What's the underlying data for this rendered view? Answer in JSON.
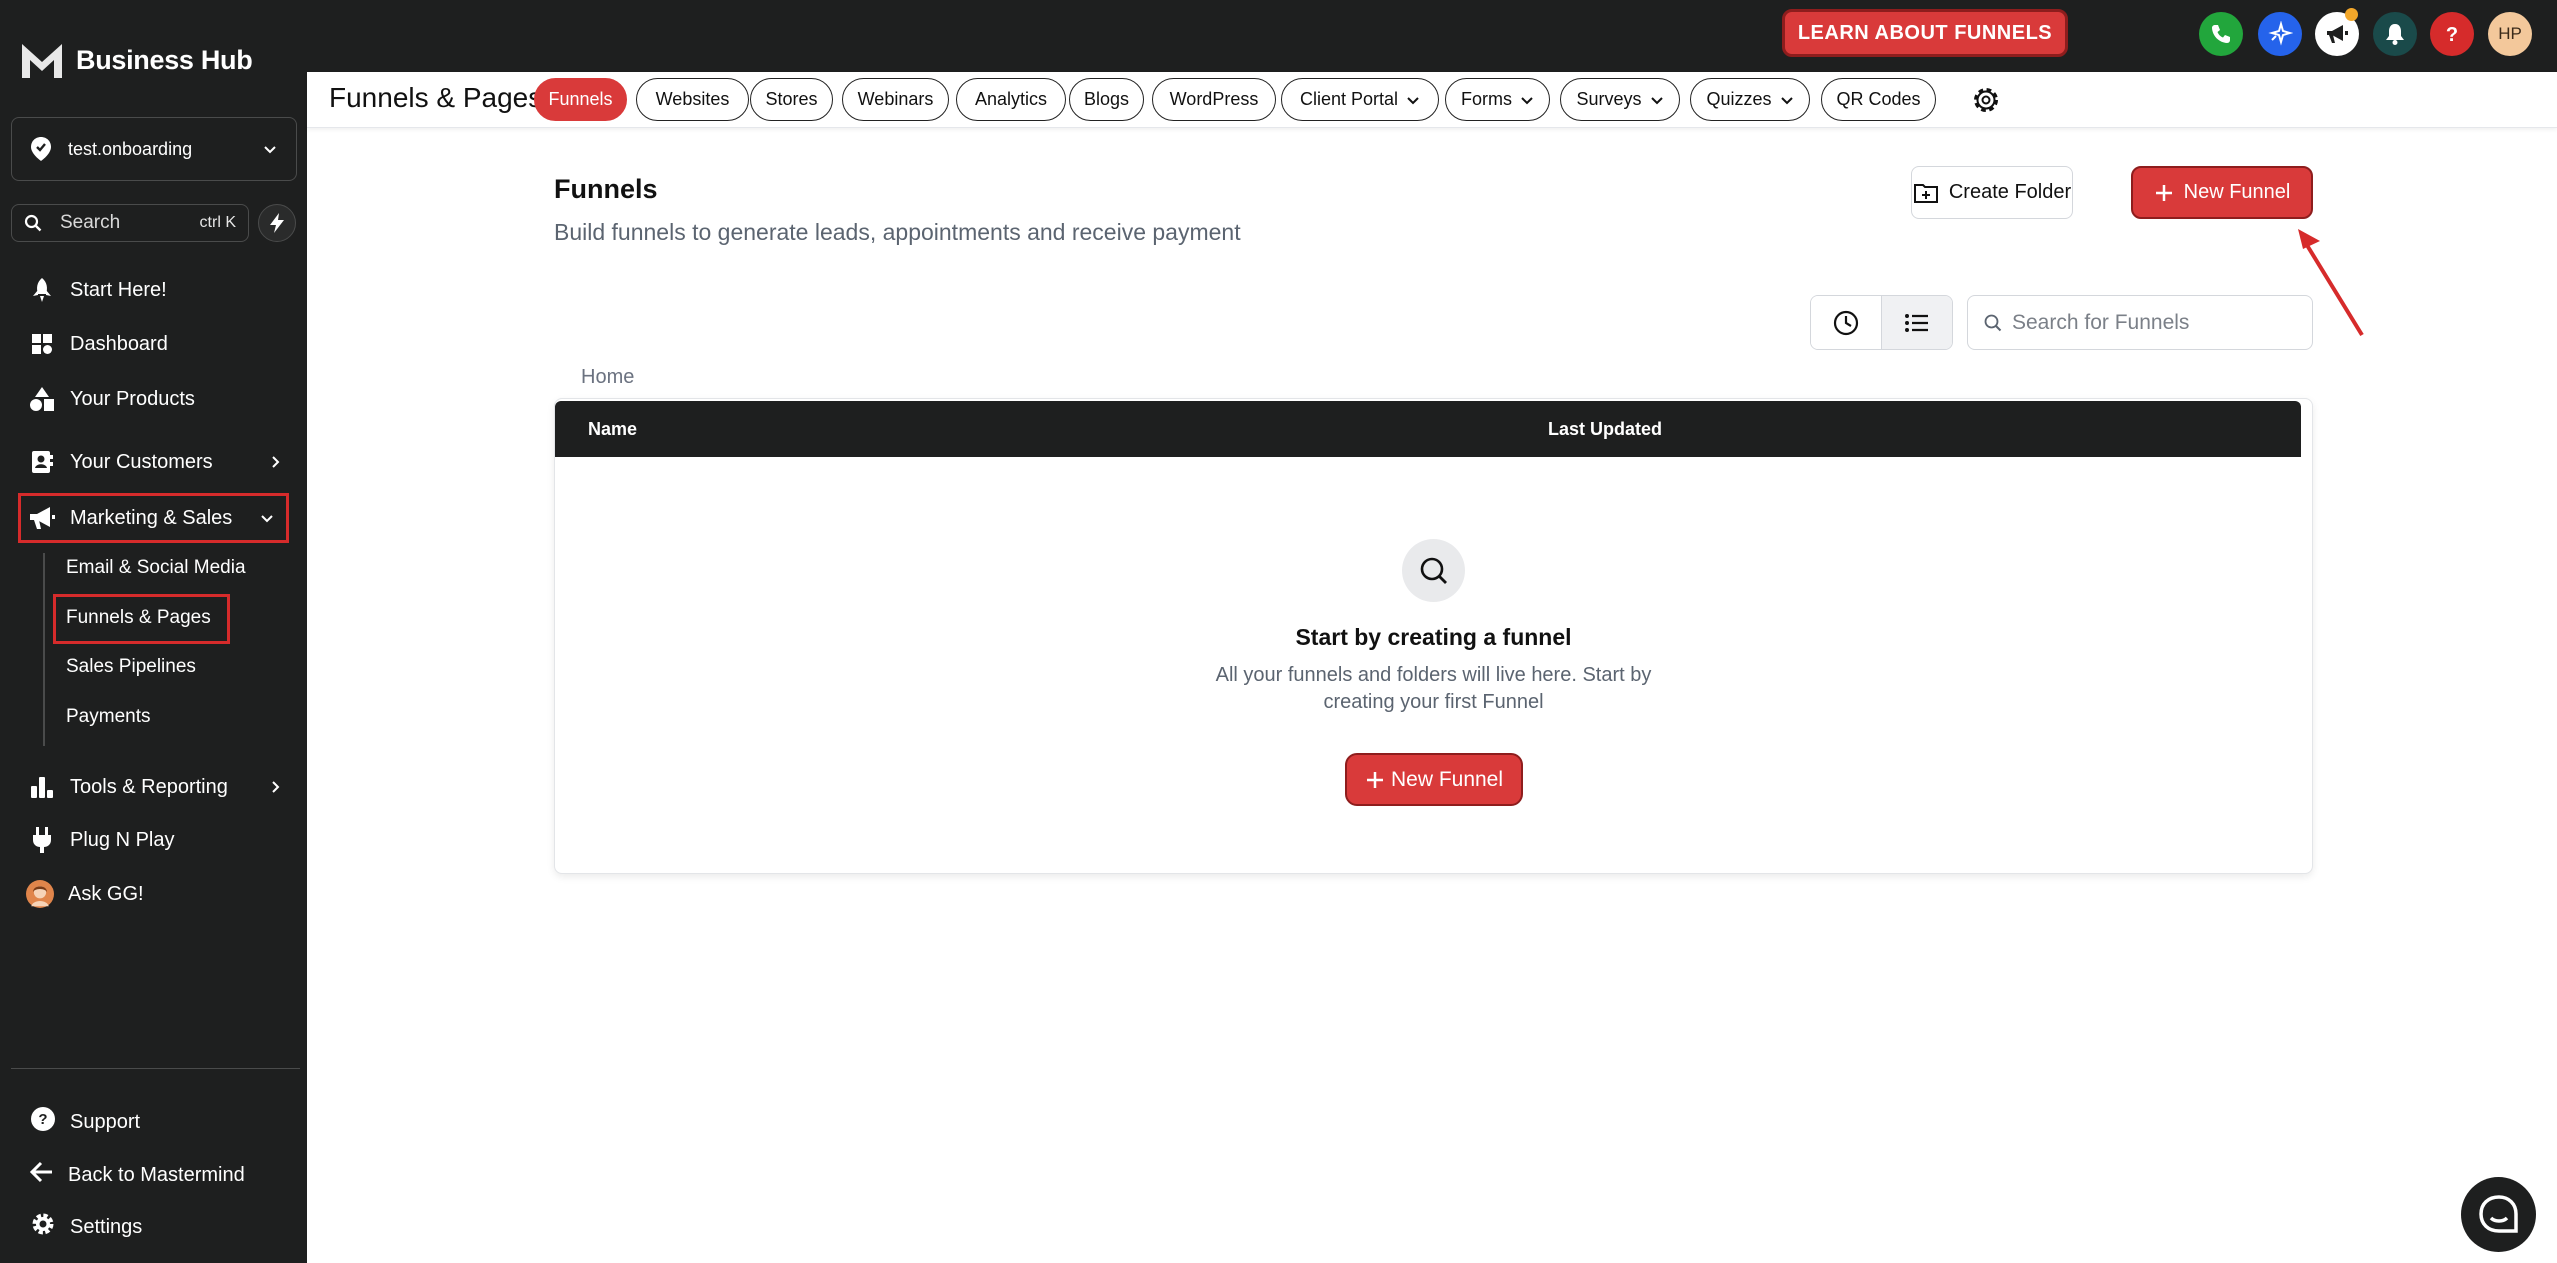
{
  "brand": {
    "name": "Business Hub",
    "icon": "m-logo-icon"
  },
  "sidebar": {
    "location": "test.onboarding",
    "search_label": "Search",
    "search_shortcut": "ctrl K",
    "items": [
      {
        "label": "Start Here!",
        "icon": "rocket-icon"
      },
      {
        "label": "Dashboard",
        "icon": "dashboard-icon"
      },
      {
        "label": "Your Products",
        "icon": "shapes-icon"
      },
      {
        "label": "Your Customers",
        "icon": "contact-card-icon"
      },
      {
        "label": "Marketing & Sales",
        "icon": "megaphone-icon"
      },
      {
        "label": "Tools & Reporting",
        "icon": "bar-chart-icon"
      },
      {
        "label": "Plug N Play",
        "icon": "plug-icon"
      },
      {
        "label": "Ask GG!",
        "icon": "avatar"
      }
    ],
    "sub_items": [
      {
        "label": "Email & Social Media"
      },
      {
        "label": "Funnels & Pages"
      },
      {
        "label": "Sales Pipelines"
      },
      {
        "label": "Payments"
      }
    ],
    "bottom_items": [
      {
        "label": "Support",
        "icon": "help-circle-icon"
      },
      {
        "label": "Back to Mastermind",
        "icon": "arrow-left-icon"
      },
      {
        "label": "Settings",
        "icon": "gear-icon"
      }
    ]
  },
  "topbar": {
    "learn_button": "LEARN ABOUT FUNNELS",
    "avatar_initials": "HP",
    "icon_colors": {
      "phone": "#22a63c",
      "ai": "#2563eb",
      "megaphone": "#ffffff",
      "bell": "#1a4a4a",
      "help": "#d62b2b"
    }
  },
  "subnav": {
    "title": "Funnels & Pages",
    "tabs": [
      {
        "label": "Funnels",
        "active": true
      },
      {
        "label": "Websites"
      },
      {
        "label": "Stores"
      },
      {
        "label": "Webinars"
      },
      {
        "label": "Analytics"
      },
      {
        "label": "Blogs"
      },
      {
        "label": "WordPress"
      },
      {
        "label": "Client Portal",
        "dropdown": true
      },
      {
        "label": "Forms",
        "dropdown": true
      },
      {
        "label": "Surveys",
        "dropdown": true
      },
      {
        "label": "Quizzes",
        "dropdown": true
      },
      {
        "label": "QR Codes"
      }
    ]
  },
  "main": {
    "title": "Funnels",
    "subtitle": "Build funnels to generate leads, appointments and receive payment",
    "create_folder": "Create Folder",
    "new_funnel": "New Funnel",
    "search_placeholder": "Search for Funnels",
    "breadcrumb": "Home",
    "table": {
      "columns": [
        "Name",
        "Last Updated"
      ]
    },
    "empty": {
      "title": "Start by creating a funnel",
      "desc": "All your funnels and folders will live here. Start by creating your first Funnel",
      "button": "New Funnel"
    }
  },
  "colors": {
    "accent": "#d93a3a",
    "sidebar_bg": "#1e1f1f",
    "highlight_box": "#d62b2b"
  }
}
